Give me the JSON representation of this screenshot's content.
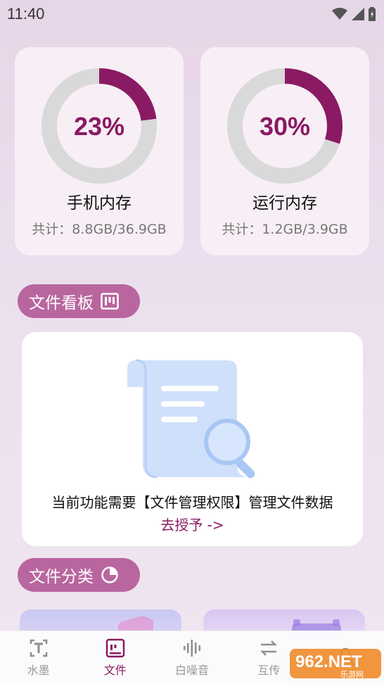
{
  "status_bar": {
    "time": "11:40"
  },
  "memory": {
    "phone": {
      "percent": 23,
      "percent_label": "23%",
      "title": "手机内存",
      "detail": "共计：8.8GB/36.9GB"
    },
    "ram": {
      "percent": 30,
      "percent_label": "30%",
      "title": "运行内存",
      "detail": "共计：1.2GB/3.9GB"
    }
  },
  "board": {
    "title": "文件看板",
    "message": "当前功能需要【文件管理权限】管理文件数据",
    "action": "去授予 ->"
  },
  "category": {
    "title": "文件分类"
  },
  "nav": {
    "items": [
      {
        "label": "水墨",
        "icon": "text-icon",
        "active": false
      },
      {
        "label": "文件",
        "icon": "file-board-icon",
        "active": true
      },
      {
        "label": "白噪音",
        "icon": "sound-wave-icon",
        "active": false
      },
      {
        "label": "互传",
        "icon": "transfer-icon",
        "active": false
      },
      {
        "label": "",
        "icon": "user-icon",
        "active": false
      }
    ]
  },
  "watermark": {
    "text": "962.NET",
    "subtext": "乐游网"
  },
  "colors": {
    "accent": "#8a1a63",
    "pill": "#b9669f",
    "ring_track": "#d9d9d9"
  }
}
